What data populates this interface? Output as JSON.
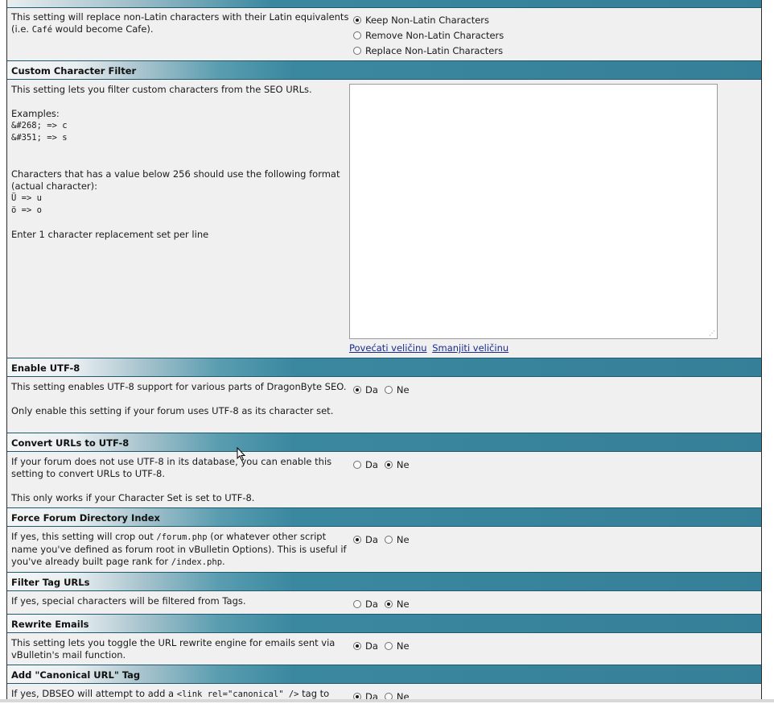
{
  "settings": {
    "non_latin": {
      "desc": "This setting will replace non-Latin characters with their Latin equivalents",
      "desc_pre": "(i.e. ",
      "desc_code": "Café",
      "desc_post": " would become Cafe).",
      "options": [
        "Keep Non-Latin Characters",
        "Remove Non-Latin Characters",
        "Replace Non-Latin Characters"
      ],
      "selected": 0
    },
    "custom_filter": {
      "title": "Custom Character Filter",
      "desc": "This setting lets you filter custom characters from the SEO URLs.",
      "examples_label": "Examples:",
      "example1": "&#268; => c",
      "example2": "&#351; => s",
      "format_note": "Characters that has a value below 256 should use the following format (actual character):",
      "example3": "Ü => u",
      "example4": "ö => o",
      "per_line": "Enter 1 character replacement set per line",
      "textarea_value": "",
      "enlarge": "Povećati veličinu",
      "shrink": "Smanjiti veličinu"
    },
    "utf8": {
      "title": "Enable UTF-8",
      "desc": "This setting enables UTF-8 support for various parts of DragonByte SEO.",
      "desc2": "Only enable this setting if your forum uses UTF-8 as its character set.",
      "yes": "Da",
      "no": "Ne",
      "value": "yes"
    },
    "convert_utf8": {
      "title": "Convert URLs to UTF-8",
      "desc": "If your forum does not use UTF-8 in its database, you can enable this setting to convert URLs to UTF-8.",
      "desc2": "This only works if your Character Set is set to UTF-8.",
      "yes": "Da",
      "no": "Ne",
      "value": "no"
    },
    "force_index": {
      "title": "Force Forum Directory Index",
      "desc_a": "If yes, this setting will crop out ",
      "code_a": "/forum.php",
      "desc_b": " (or whatever other script name you've defined as forum root in vBulletin Options). This is useful if you've already built page rank for ",
      "code_b": "/index.php",
      "desc_c": ".",
      "yes": "Da",
      "no": "Ne",
      "value": "yes"
    },
    "filter_tags": {
      "title": "Filter Tag URLs",
      "desc": "If yes, special characters will be filtered from Tags.",
      "yes": "Da",
      "no": "Ne",
      "value": "no"
    },
    "rewrite_emails": {
      "title": "Rewrite Emails",
      "desc": "This setting lets you toggle the URL rewrite engine for emails sent via vBulletin's mail function.",
      "yes": "Da",
      "no": "Ne",
      "value": "yes"
    },
    "canonical": {
      "title": "Add \"Canonical URL\" Tag",
      "desc_a": "If yes, DBSEO will attempt to add a ",
      "code_a": "<link rel=\"canonical\" />",
      "desc_b": " tag to",
      "yes": "Da",
      "no": "Ne",
      "value": "yes"
    }
  },
  "colors": {
    "header_blue": "#367f98",
    "panel_bg": "#f0f0f0",
    "link": "#1a2a8f"
  }
}
